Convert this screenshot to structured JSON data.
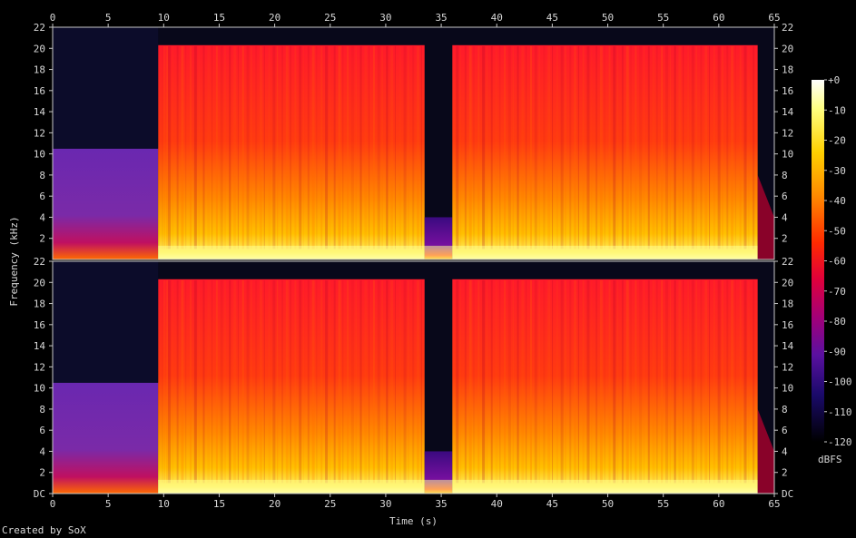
{
  "chart_data": {
    "type": "heatmap",
    "title": "",
    "xlabel": "Time (s)",
    "ylabel": "Frequency (kHz)",
    "colorbar_label": "dBFS",
    "xlim": [
      0,
      65
    ],
    "ylim_khz": [
      0,
      22
    ],
    "x_ticks": [
      "0",
      "5",
      "10",
      "15",
      "20",
      "25",
      "30",
      "35",
      "40",
      "45",
      "50",
      "55",
      "60",
      "65"
    ],
    "y_ticks_top": [
      "2",
      "4",
      "6",
      "8",
      "10",
      "12",
      "14",
      "16",
      "18",
      "20",
      "22"
    ],
    "y_ticks_bottom": [
      "DC",
      "2",
      "4",
      "6",
      "8",
      "10",
      "12",
      "14",
      "16",
      "18",
      "20",
      "22"
    ],
    "colorbar_ticks": [
      "+0",
      "-10",
      "-20",
      "-30",
      "-40",
      "-50",
      "-60",
      "-70",
      "-80",
      "-90",
      "-100",
      "-110",
      "-120"
    ],
    "channels": [
      {
        "name": "",
        "segments": [
          {
            "t_start": 0,
            "t_end": 9.5,
            "cutoff_khz": 10.5,
            "level_db": -90
          },
          {
            "t_start": 9.5,
            "t_end": 33.5,
            "cutoff_khz": 20.3,
            "level_db": -55
          },
          {
            "t_start": 33.5,
            "t_end": 36,
            "cutoff_khz": 4,
            "level_db": -75
          },
          {
            "t_start": 36,
            "t_end": 63.5,
            "cutoff_khz": 20.3,
            "level_db": -55
          }
        ]
      },
      {
        "name": "",
        "segments": [
          {
            "t_start": 0,
            "t_end": 9.5,
            "cutoff_khz": 10.5,
            "level_db": -90
          },
          {
            "t_start": 9.5,
            "t_end": 33.5,
            "cutoff_khz": 20.3,
            "level_db": -55
          },
          {
            "t_start": 33.5,
            "t_end": 36,
            "cutoff_khz": 4,
            "level_db": -75
          },
          {
            "t_start": 36,
            "t_end": 63.5,
            "cutoff_khz": 20.3,
            "level_db": -55
          }
        ]
      }
    ]
  },
  "credit": "Created by SoX"
}
